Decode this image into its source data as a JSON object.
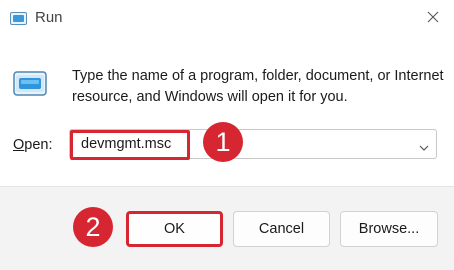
{
  "window": {
    "title": "Run"
  },
  "dialog": {
    "description": "Type the name of a program, folder, document, or Internet resource, and Windows will open it for you.",
    "open_label_mnemonic": "O",
    "open_label_rest": "pen:",
    "open_value": "devmgmt.msc"
  },
  "buttons": {
    "ok": "OK",
    "cancel": "Cancel",
    "browse": "Browse..."
  },
  "annotations": {
    "step1": "1",
    "step2": "2"
  },
  "colors": {
    "annotation_red": "#d62632",
    "footer_bg": "#f3f3f3"
  }
}
